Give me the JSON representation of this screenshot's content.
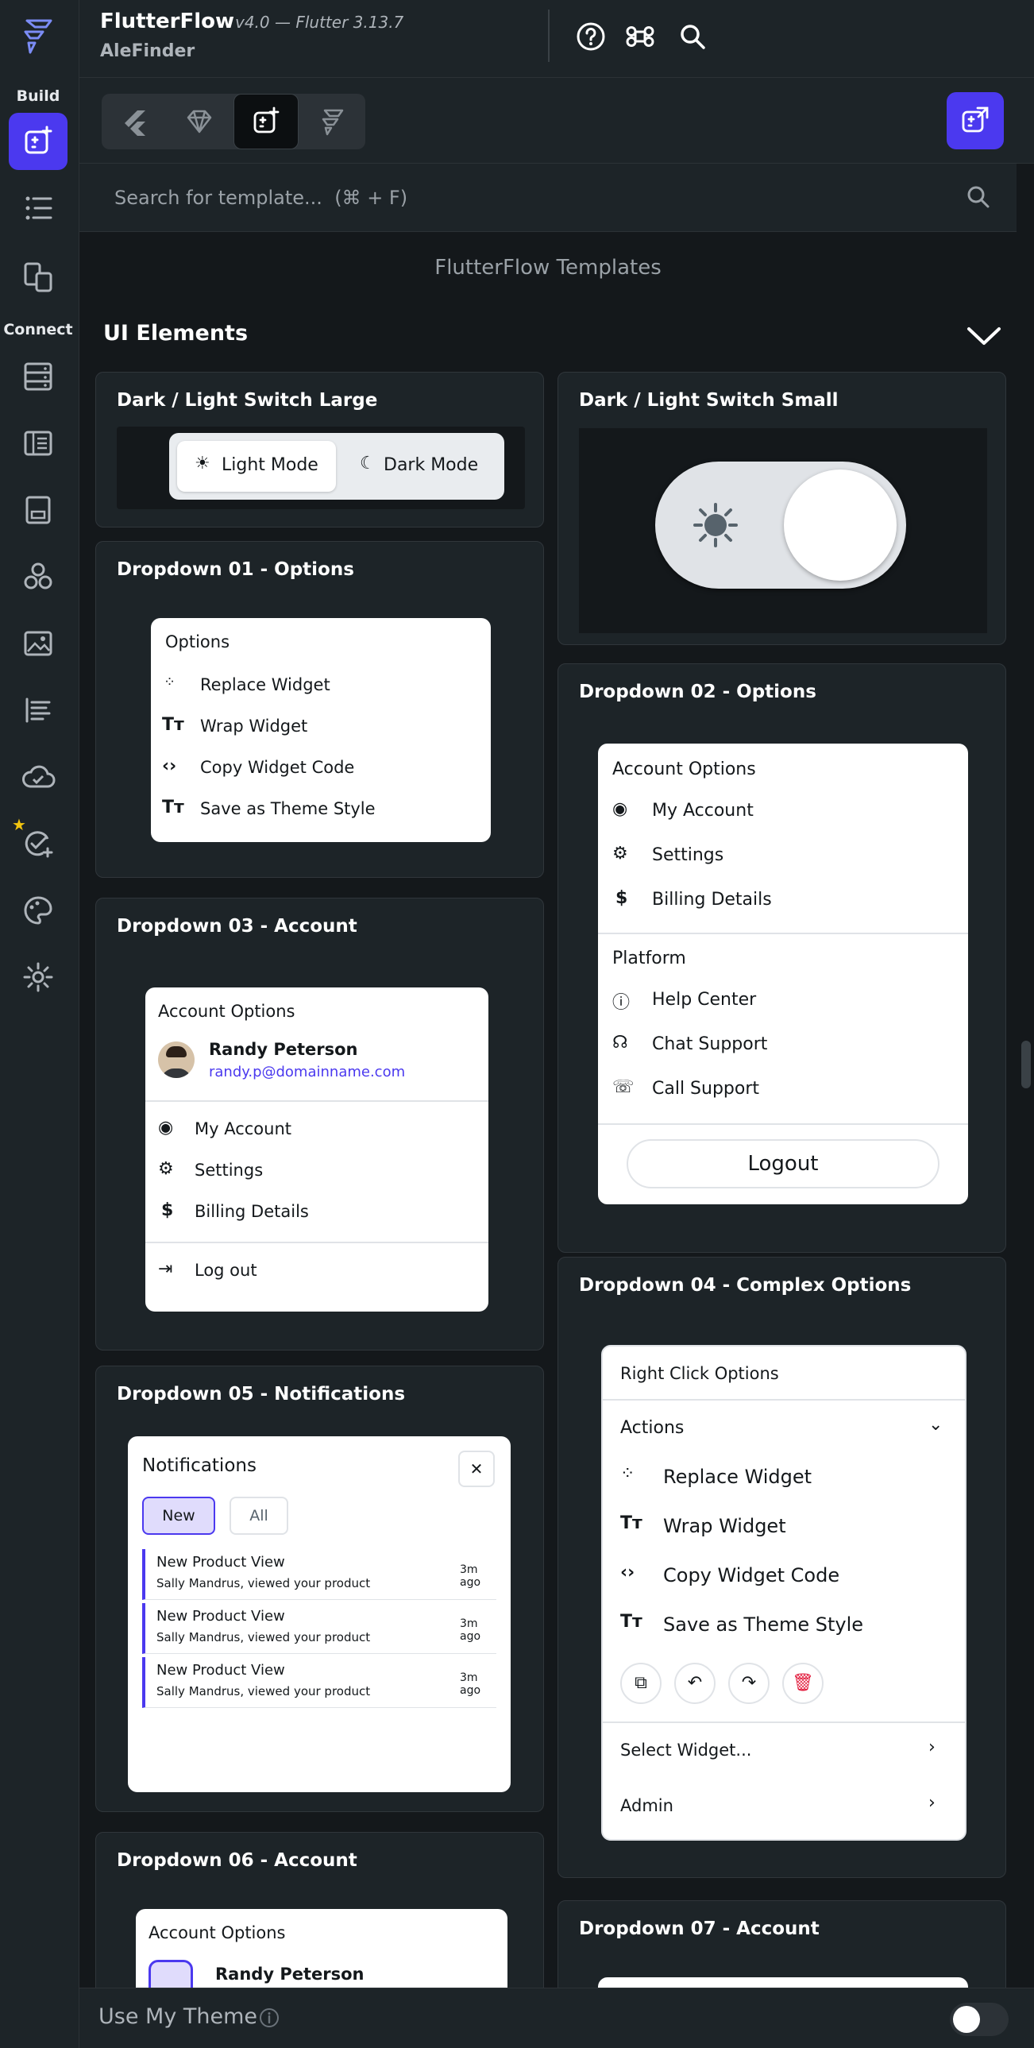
{
  "app": {
    "name": "FlutterFlow",
    "version": "v4.0 — Flutter 3.13.7",
    "project": "AleFinder"
  },
  "rail": {
    "build_label": "Build",
    "connect_label": "Connect"
  },
  "search": {
    "placeholder": "Search for template...  (⌘ + F)"
  },
  "content": {
    "heading": "FlutterFlow Templates",
    "section": "UI Elements"
  },
  "cards": {
    "c1": {
      "title": "Dark / Light Switch Large",
      "light": "Light Mode",
      "dark": "Dark Mode"
    },
    "c2": {
      "title": "Dark / Light Switch Small"
    },
    "c3": {
      "title": "Dropdown 01 - Options",
      "header": "Options",
      "items": [
        "Replace Widget",
        "Wrap Widget",
        "Copy Widget Code",
        "Save as Theme Style"
      ]
    },
    "c4": {
      "title": "Dropdown 02 - Options",
      "header1": "Account Options",
      "items1": [
        "My Account",
        "Settings",
        "Billing Details"
      ],
      "header2": "Platform",
      "items2": [
        "Help Center",
        "Chat Support",
        "Call Support"
      ],
      "button": "Logout"
    },
    "c5": {
      "title": "Dropdown 03 - Account",
      "header": "Account Options",
      "name": "Randy Peterson",
      "email": "randy.p@domainname.com",
      "items": [
        "My Account",
        "Settings",
        "Billing Details"
      ],
      "logout": "Log out"
    },
    "c6": {
      "title": "Dropdown 04 - Complex Options",
      "header": "Right Click Options",
      "actions": "Actions",
      "items": [
        "Replace Widget",
        "Wrap Widget",
        "Copy Widget Code",
        "Save as Theme Style"
      ],
      "select": "Select Widget...",
      "admin": "Admin"
    },
    "c7": {
      "title": "Dropdown 05 - Notifications",
      "header": "Notifications",
      "tab_new": "New",
      "tab_all": "All",
      "notifs": [
        {
          "title": "New Product View",
          "sub": "Sally Mandrus, viewed your product",
          "time": "3m ago"
        },
        {
          "title": "New Product View",
          "sub": "Sally Mandrus, viewed your product",
          "time": "3m ago"
        },
        {
          "title": "New Product View",
          "sub": "Sally Mandrus, viewed your product",
          "time": "3m ago"
        }
      ]
    },
    "c8": {
      "title": "Dropdown 06 - Account",
      "header": "Account Options",
      "name": "Randy Peterson"
    },
    "c9": {
      "title": "Dropdown 07 - Account"
    }
  },
  "footer": {
    "label": "Use My Theme"
  },
  "colors": {
    "accent": "#4b39ef",
    "bg": "#14181b",
    "surface": "#1d2428"
  }
}
